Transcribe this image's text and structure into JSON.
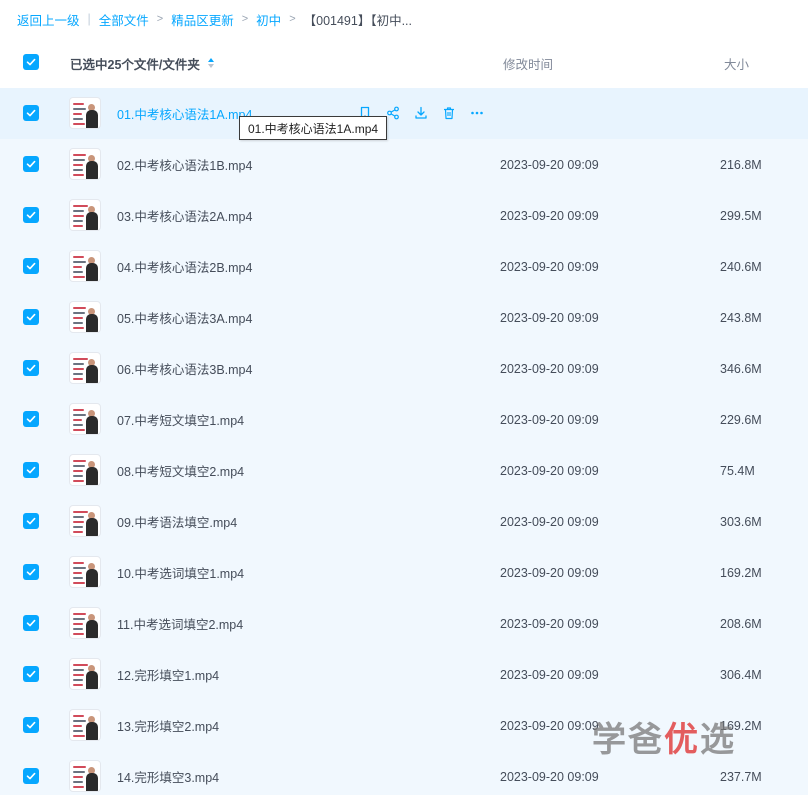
{
  "breadcrumb": {
    "back": "返回上一级",
    "sep": "|",
    "items": [
      "全部文件",
      "精品区更新",
      "初中"
    ],
    "current": "【001491】【初中..."
  },
  "header": {
    "selected_label": "已选中25个文件/文件夹",
    "mtime_label": "修改时间",
    "size_label": "大小"
  },
  "tooltip": "01.中考核心语法1A.mp4",
  "files": [
    {
      "name": "01.中考核心语法1A.mp4",
      "mtime": "",
      "size": ""
    },
    {
      "name": "02.中考核心语法1B.mp4",
      "mtime": "2023-09-20 09:09",
      "size": "216.8M"
    },
    {
      "name": "03.中考核心语法2A.mp4",
      "mtime": "2023-09-20 09:09",
      "size": "299.5M"
    },
    {
      "name": "04.中考核心语法2B.mp4",
      "mtime": "2023-09-20 09:09",
      "size": "240.6M"
    },
    {
      "name": "05.中考核心语法3A.mp4",
      "mtime": "2023-09-20 09:09",
      "size": "243.8M"
    },
    {
      "name": "06.中考核心语法3B.mp4",
      "mtime": "2023-09-20 09:09",
      "size": "346.6M"
    },
    {
      "name": "07.中考短文填空1.mp4",
      "mtime": "2023-09-20 09:09",
      "size": "229.6M"
    },
    {
      "name": "08.中考短文填空2.mp4",
      "mtime": "2023-09-20 09:09",
      "size": "75.4M"
    },
    {
      "name": "09.中考语法填空.mp4",
      "mtime": "2023-09-20 09:09",
      "size": "303.6M"
    },
    {
      "name": "10.中考选词填空1.mp4",
      "mtime": "2023-09-20 09:09",
      "size": "169.2M"
    },
    {
      "name": "11.中考选词填空2.mp4",
      "mtime": "2023-09-20 09:09",
      "size": "208.6M"
    },
    {
      "name": "12.完形填空1.mp4",
      "mtime": "2023-09-20 09:09",
      "size": "306.4M"
    },
    {
      "name": "13.完形填空2.mp4",
      "mtime": "2023-09-20 09:09",
      "size": "169.2M"
    },
    {
      "name": "14.完形填空3.mp4",
      "mtime": "2023-09-20 09:09",
      "size": "237.7M"
    }
  ],
  "row_icons": [
    "bookmark-icon",
    "share-icon",
    "download-icon",
    "delete-icon",
    "more-icon"
  ],
  "watermark": {
    "part1": "学爸",
    "part2": "优",
    "part3": "选"
  },
  "colors": {
    "accent": "#06a7ff",
    "row_bg": "#f1f8fe",
    "text": "#454d5a"
  }
}
